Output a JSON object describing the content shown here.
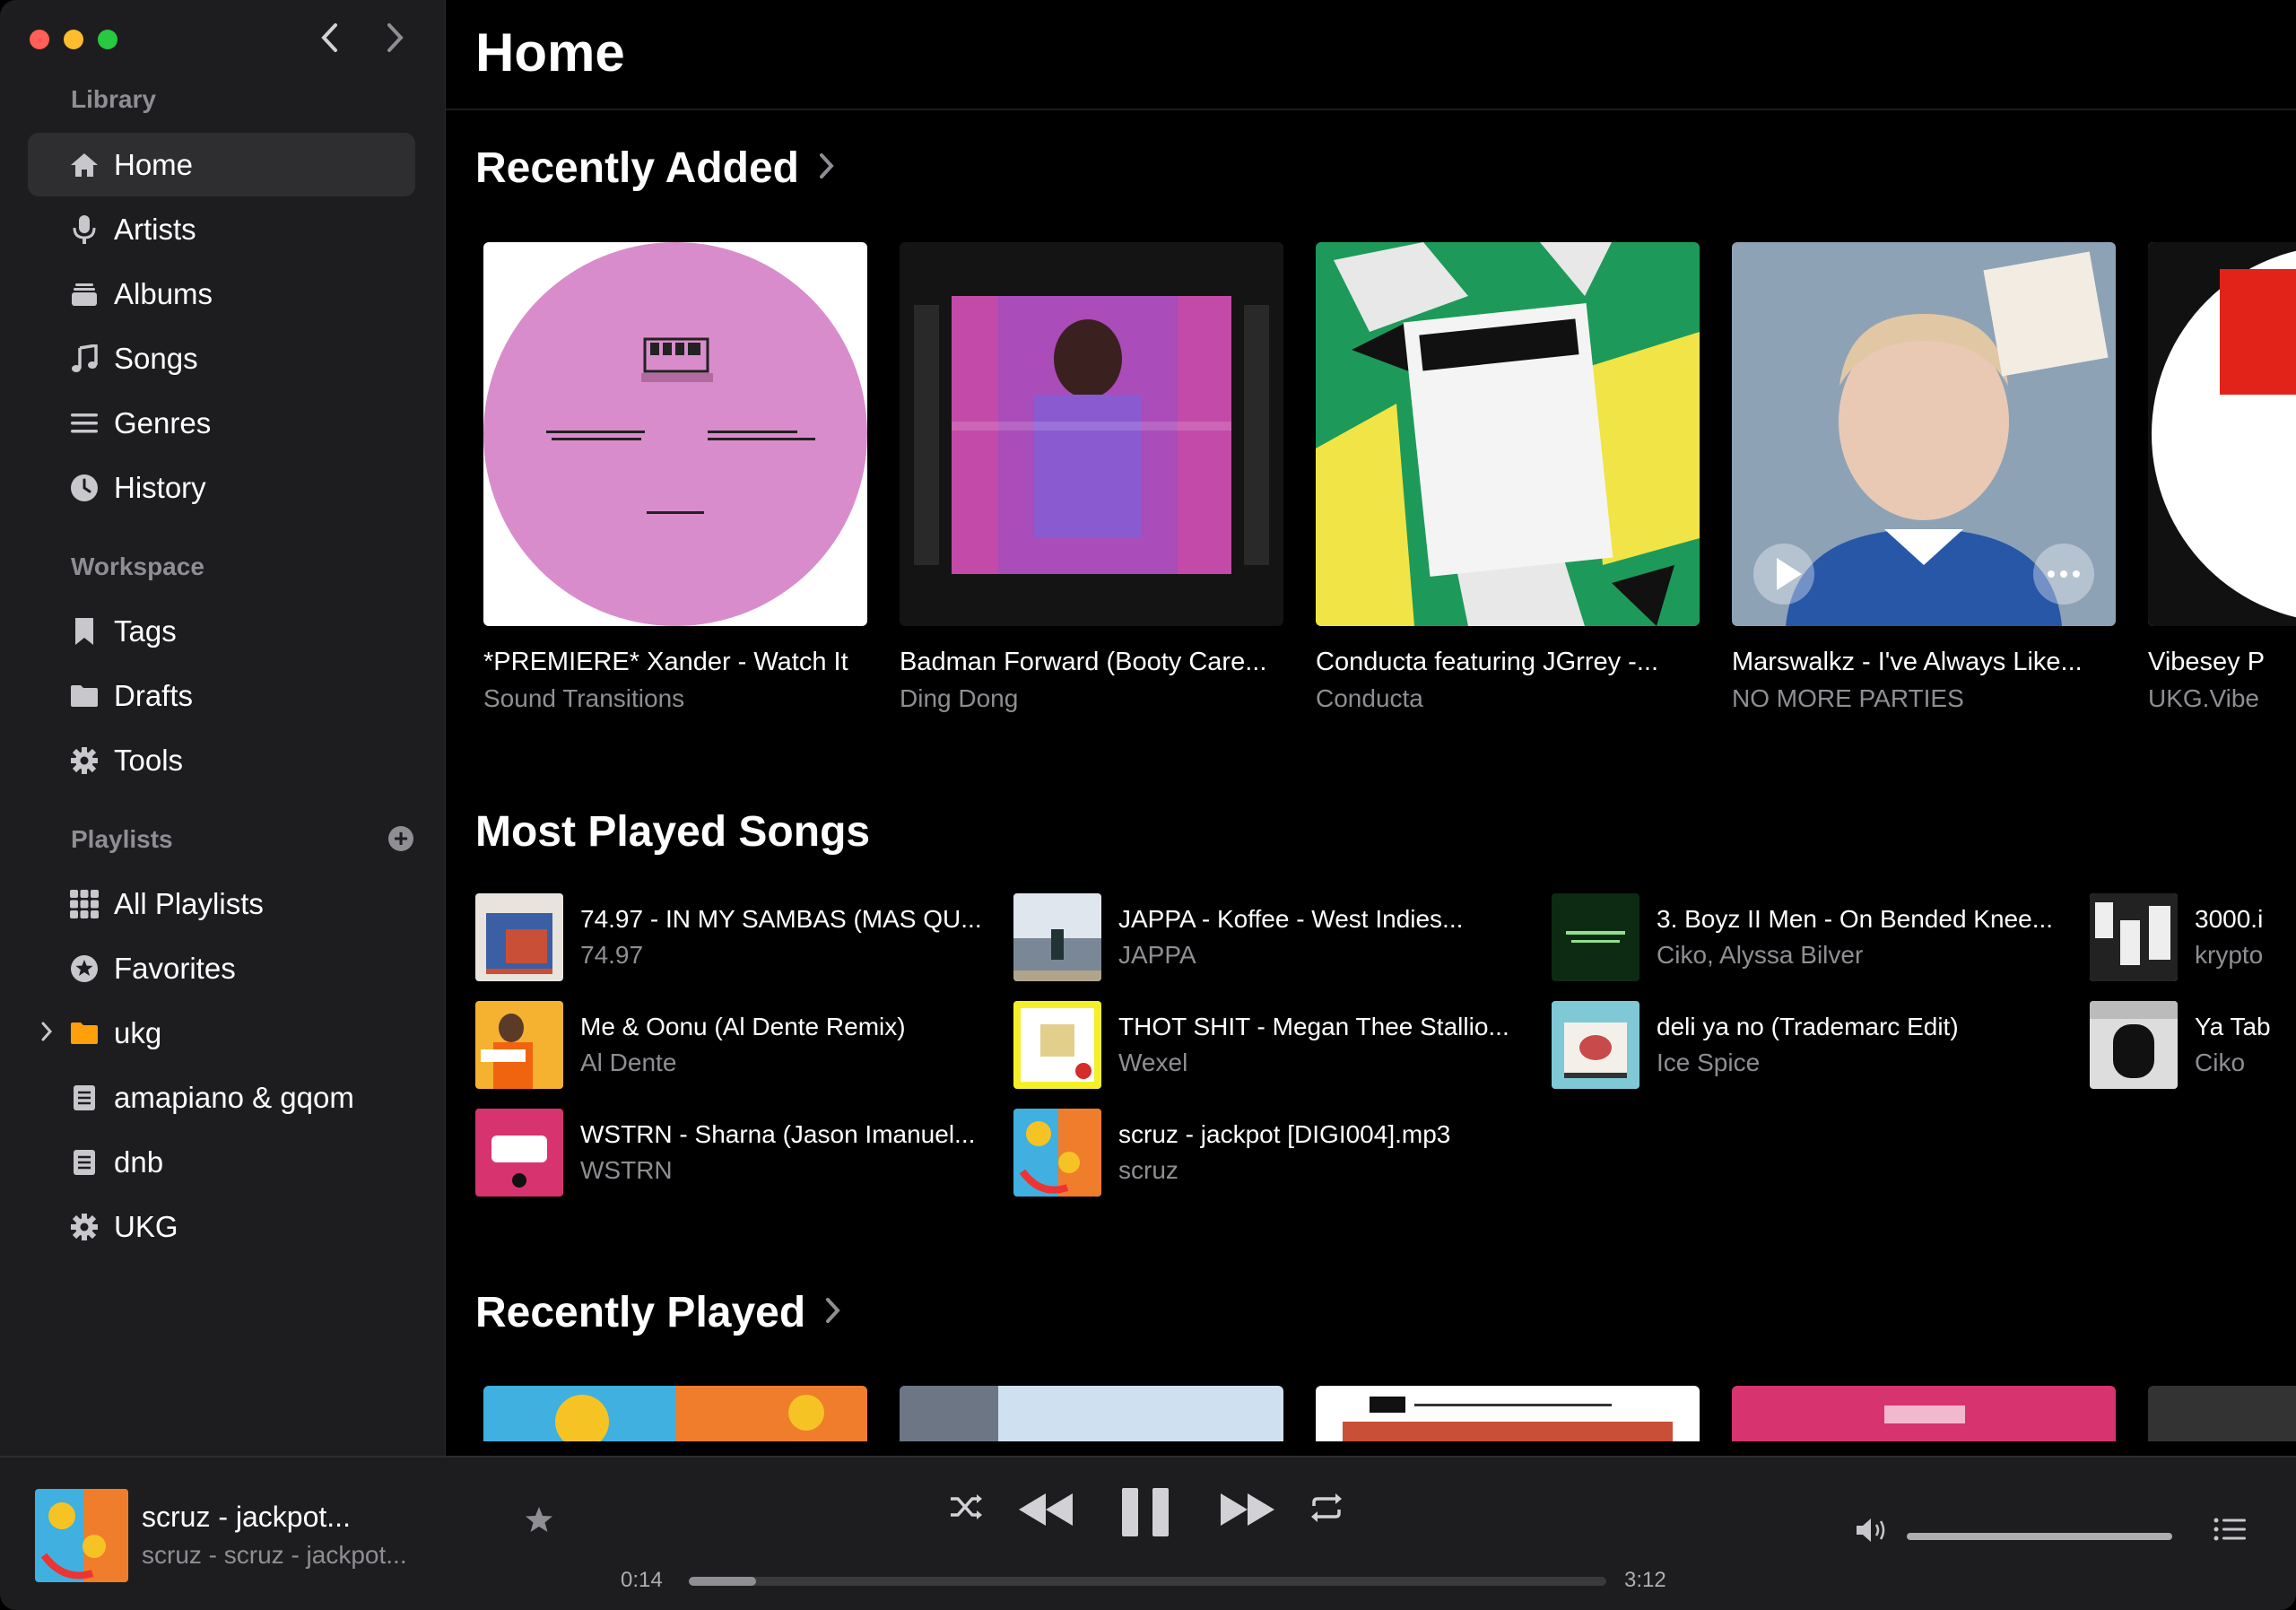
{
  "window": {
    "controls": [
      "close",
      "minimize",
      "zoom"
    ]
  },
  "sidebar": {
    "library_label": "Library",
    "library_items": [
      {
        "label": "Home",
        "icon": "home-icon",
        "active": true
      },
      {
        "label": "Artists",
        "icon": "microphone-icon"
      },
      {
        "label": "Albums",
        "icon": "album-stack-icon"
      },
      {
        "label": "Songs",
        "icon": "music-note-icon"
      },
      {
        "label": "Genres",
        "icon": "list-icon"
      },
      {
        "label": "History",
        "icon": "clock-icon"
      }
    ],
    "workspace_label": "Workspace",
    "workspace_items": [
      {
        "label": "Tags",
        "icon": "bookmark-icon"
      },
      {
        "label": "Drafts",
        "icon": "folder-icon"
      },
      {
        "label": "Tools",
        "icon": "gear-icon"
      }
    ],
    "playlists_label": "Playlists",
    "playlist_items": [
      {
        "label": "All Playlists",
        "icon": "grid-icon"
      },
      {
        "label": "Favorites",
        "icon": "star-circle-icon"
      },
      {
        "label": "ukg",
        "icon": "folder-icon"
      },
      {
        "label": "amapiano & gqom",
        "icon": "playlist-icon"
      },
      {
        "label": "dnb",
        "icon": "playlist-icon"
      },
      {
        "label": "UKG",
        "icon": "gear-icon"
      }
    ]
  },
  "main": {
    "page_title": "Home",
    "recently_added": {
      "heading": "Recently Added",
      "cards": [
        {
          "title": "*PREMIERE* Xander - Watch It",
          "subtitle": "Sound Transitions"
        },
        {
          "title": "Badman Forward (Booty Care...",
          "subtitle": "Ding Dong"
        },
        {
          "title": "Conducta featuring JGrrey -...",
          "subtitle": "Conducta"
        },
        {
          "title": "Marswalkz - I've Always Like...",
          "subtitle": "NO MORE PARTIES"
        },
        {
          "title": "Vibesey P",
          "subtitle": "UKG.Vibe"
        }
      ]
    },
    "most_played": {
      "heading": "Most Played Songs",
      "songs": [
        {
          "title": "74.97 - IN MY SAMBAS (MAS QU...",
          "artist": "74.97"
        },
        {
          "title": "Me & Oonu (Al Dente Remix)",
          "artist": "Al Dente"
        },
        {
          "title": "WSTRN - Sharna (Jason Imanuel...",
          "artist": "WSTRN"
        },
        {
          "title": "JAPPA - Koffee - West Indies...",
          "artist": "JAPPA"
        },
        {
          "title": "THOT SHIT - Megan Thee Stallio...",
          "artist": "Wexel"
        },
        {
          "title": "scruz - jackpot [DIGI004].mp3",
          "artist": "scruz"
        },
        {
          "title": "3. Boyz II Men - On Bended Knee...",
          "artist": "Ciko, Alyssa Bilver"
        },
        {
          "title": "deli ya no (Trademarc Edit)",
          "artist": "Ice Spice"
        },
        {
          "title": "3000.i",
          "artist": "krypto"
        },
        {
          "title": "Ya Tab",
          "artist": "Ciko"
        }
      ]
    },
    "recently_played": {
      "heading": "Recently Played"
    }
  },
  "player": {
    "title": "scruz - jackpot...",
    "subtitle": "scruz - scruz - jackpot...",
    "current_time": "0:14",
    "total_time": "3:12",
    "progress": 0.073,
    "volume": 1.0
  }
}
